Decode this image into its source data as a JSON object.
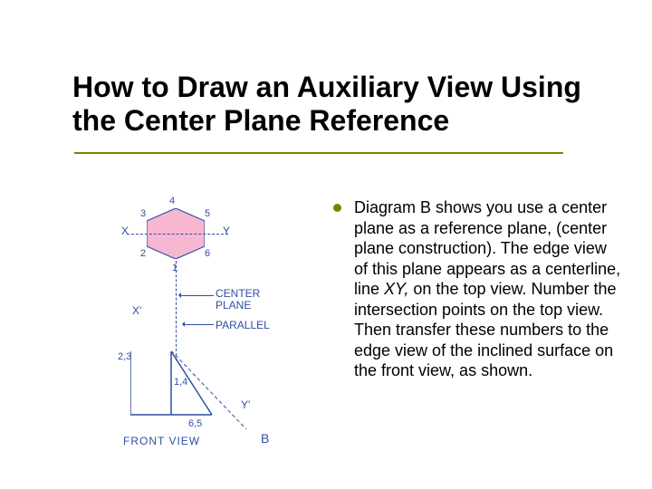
{
  "title": "How to Draw an Auxiliary View Using the Center Plane Reference",
  "bullet": {
    "pre": "Diagram B shows you use a center plane as a reference plane, (center plane construction). The edge view of this plane appears as a centerline, line ",
    "em": "XY,",
    "post": " on the top view. Number the intersection points on the top view. Then transfer these numbers to the edge view of the inclined surface on the front view, as shown."
  },
  "figure": {
    "top_labels": {
      "n1": "1",
      "n2": "2",
      "n3": "3",
      "n4": "4",
      "n5": "5",
      "n6": "6",
      "X": "X",
      "Y": "Y"
    },
    "mid_labels": {
      "center_plane": "CENTER\nPLANE",
      "parallel": "PARALLEL",
      "Xp": "X'",
      "Yp": "Y'"
    },
    "front_labels": {
      "p23": "2,3",
      "p14": "1,4",
      "p65": "6,5",
      "caption": "FRONT VIEW",
      "figletter": "B"
    }
  }
}
